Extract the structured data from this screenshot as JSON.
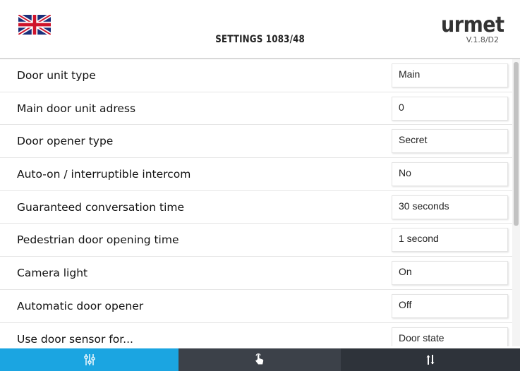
{
  "header": {
    "title": "SETTINGS 1083/48",
    "logo_text": "urmet",
    "version": "V.1.8/D2",
    "flag_icon": "uk-flag-icon"
  },
  "settings": [
    {
      "label": "Door unit type",
      "value": "Main"
    },
    {
      "label": "Main door unit adress",
      "value": "0"
    },
    {
      "label": "Door opener type",
      "value": "Secret"
    },
    {
      "label": "Auto-on / interruptible intercom",
      "value": "No"
    },
    {
      "label": "Guaranteed conversation time",
      "value": "30 seconds"
    },
    {
      "label": "Pedestrian door opening time",
      "value": "1 second"
    },
    {
      "label": "Camera light",
      "value": "On"
    },
    {
      "label": "Automatic door opener",
      "value": "Off"
    },
    {
      "label": "Use door sensor for...",
      "value": "Door state"
    }
  ],
  "bottom_bar": {
    "tabs": [
      {
        "icon": "sliders-icon",
        "active": true
      },
      {
        "icon": "touch-hand-icon",
        "active": false
      },
      {
        "icon": "sort-arrows-icon",
        "active": false
      }
    ]
  },
  "colors": {
    "active_tab": "#1ba5e1",
    "inactive_tab": "#3c4149"
  }
}
